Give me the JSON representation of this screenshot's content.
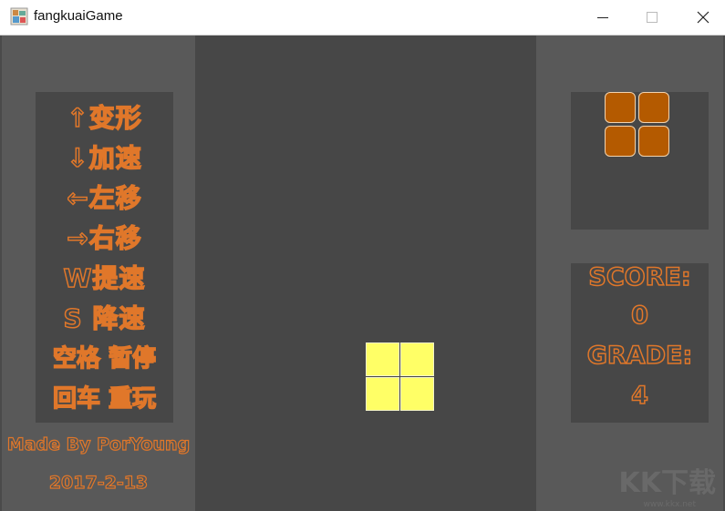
{
  "window": {
    "title": "fangkuaiGame",
    "icon": "app-icon",
    "buttons": {
      "minimize": "─",
      "maximize": "☐",
      "close": "✕"
    }
  },
  "controls": {
    "lines": [
      "↑变形",
      "↓加速",
      "←左移",
      "→右移",
      "W提速",
      "S 降速",
      "空格 暂停",
      "回车 重玩"
    ]
  },
  "credits": {
    "author": "Made By PorYoung",
    "date": "2017-2-13"
  },
  "next_piece": {
    "shape": "O",
    "color": "#b45a00"
  },
  "current_piece": {
    "shape": "O",
    "color": "#ffff66"
  },
  "score": {
    "score_label": "SCORE:",
    "score_value": "0",
    "grade_label": "GRADE:",
    "grade_value": "4"
  },
  "watermark": {
    "text": "KK下载",
    "sub": "www.kkx.net"
  },
  "colors": {
    "accent": "#e0772a",
    "panel": "#474747",
    "background": "#595959"
  }
}
